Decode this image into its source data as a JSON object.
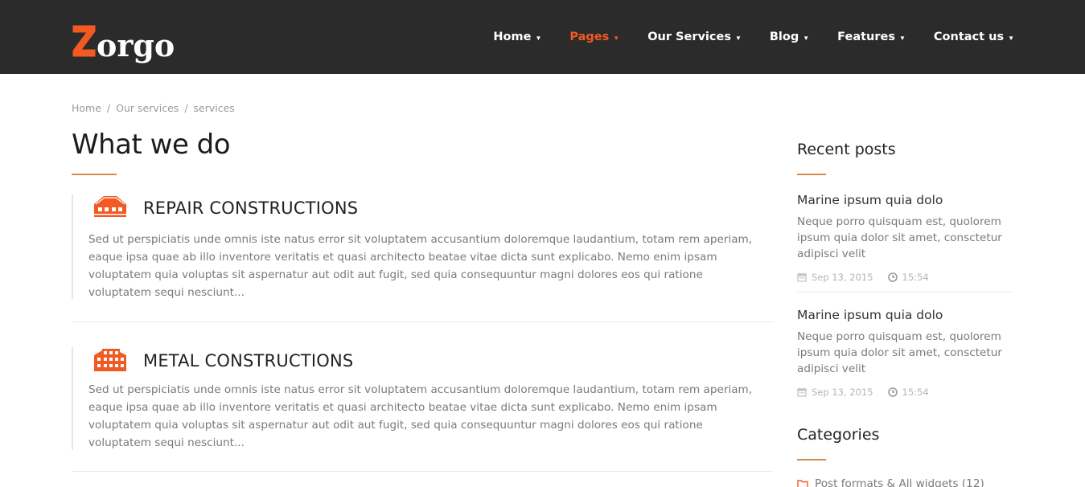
{
  "brand": {
    "logo_text": "orgo",
    "logo_initial": "Z",
    "accent": "#f15a22"
  },
  "nav": [
    {
      "label": "Home",
      "active": false
    },
    {
      "label": "Pages",
      "active": true
    },
    {
      "label": "Our Services",
      "active": false
    },
    {
      "label": "Blog",
      "active": false
    },
    {
      "label": "Features",
      "active": false
    },
    {
      "label": "Contact us",
      "active": false
    }
  ],
  "nav_caret": "▼",
  "breadcrumb": {
    "items": [
      "Home",
      "Our services",
      "services"
    ],
    "separator": "/"
  },
  "main": {
    "title": "What we do",
    "services": [
      {
        "icon": "warehouse-icon",
        "title": "REPAIR CONSTRUCTIONS",
        "text": "Sed ut perspiciatis unde omnis iste natus error sit voluptatem accusantium doloremque laudantium, totam rem aperiam, eaque ipsa quae ab illo inventore veritatis et quasi architecto beatae vitae dicta sunt explicabo. Nemo enim ipsam voluptatem quia voluptas sit aspernatur aut odit aut fugit, sed quia consequuntur magni dolores eos qui ratione voluptatem sequi nesciunt..."
      },
      {
        "icon": "building-icon",
        "title": "METAL CONSTRUCTIONS",
        "text": "Sed ut perspiciatis unde omnis iste natus error sit voluptatem accusantium doloremque laudantium, totam rem aperiam, eaque ipsa quae ab illo inventore veritatis et quasi architecto beatae vitae dicta sunt explicabo. Nemo enim ipsam voluptatem quia voluptas sit aspernatur aut odit aut fugit, sed quia consequuntur magni dolores eos qui ratione voluptatem sequi nesciunt..."
      }
    ]
  },
  "sidebar": {
    "recent_heading": "Recent posts",
    "posts": [
      {
        "title": "Marine ipsum quia dolo",
        "excerpt": "Neque porro quisquam est, quolorem ipsum quia dolor sit amet, consctetur adipisci velit",
        "date": "Sep 13, 2015",
        "time": "15:54"
      },
      {
        "title": "Marine ipsum quia dolo",
        "excerpt": "Neque porro quisquam est, quolorem ipsum quia dolor sit amet, consctetur adipisci velit",
        "date": "Sep 13, 2015",
        "time": "15:54"
      }
    ],
    "categories_heading": "Categories",
    "categories": [
      {
        "label": "Post formats & All widgets (12)"
      }
    ]
  }
}
